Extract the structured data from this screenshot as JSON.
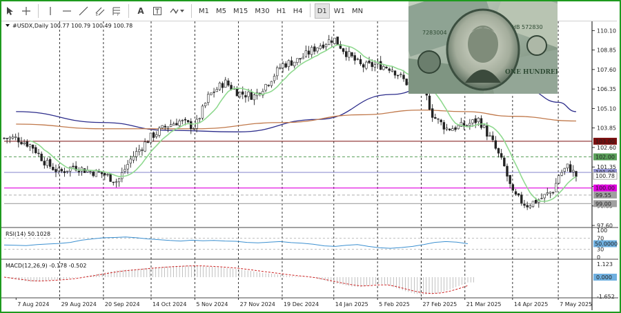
{
  "toolbar": {
    "tools": [
      "cursor-icon",
      "crosshair-icon",
      "vertical-line-icon",
      "horizontal-line-icon",
      "trendline-icon",
      "equidistant-channel-icon",
      "fibonacci-icon",
      "text-icon",
      "text-label-icon",
      "arrows-icon"
    ],
    "text_tool": "A",
    "timeframes": [
      "M1",
      "M5",
      "M15",
      "M30",
      "H1",
      "H4",
      "D1",
      "W1",
      "MN"
    ],
    "active_timeframe": "D1"
  },
  "chart_data": [
    {
      "type": "candlestick",
      "header": "#USDX,Daily  100.77 100.79 100.49 100.78",
      "ylim": [
        97.6,
        110.6
      ],
      "yticks": [
        "110.10",
        "108.85",
        "107.60",
        "106.35",
        "105.10",
        "103.85",
        "102.60",
        "101.35",
        "100.10",
        "98.85",
        "97.60"
      ],
      "x_labels": [
        "7 Aug 2024",
        "29 Aug 2024",
        "20 Sep 2024",
        "14 Oct 2024",
        "5 Nov 2024",
        "27 Nov 2024",
        "19 Dec 2024",
        "14 Jan 2025",
        "5 Feb 2025",
        "27 Feb 2025",
        "21 Mar 2025",
        "14 Apr 2025",
        "7 May 2025"
      ],
      "close_path_x": [
        "2024-08-07",
        "2024-08-15",
        "2024-08-22",
        "2024-08-29",
        "2024-09-05",
        "2024-09-12",
        "2024-09-20",
        "2024-09-27",
        "2024-10-04",
        "2024-10-14",
        "2024-10-22",
        "2024-10-28",
        "2024-11-05",
        "2024-11-12",
        "2024-11-20",
        "2024-11-27",
        "2024-12-05",
        "2024-12-12",
        "2024-12-19",
        "2024-12-27",
        "2025-01-06",
        "2025-01-14",
        "2025-01-20",
        "2025-01-28",
        "2025-02-05",
        "2025-02-12",
        "2025-02-20",
        "2025-02-27",
        "2025-03-05",
        "2025-03-12",
        "2025-03-21",
        "2025-03-28",
        "2025-04-04",
        "2025-04-10",
        "2025-04-14",
        "2025-04-21",
        "2025-04-28",
        "2025-05-05",
        "2025-05-07",
        "2025-05-12",
        "2025-05-16"
      ],
      "close": [
        103.2,
        102.7,
        101.6,
        101.0,
        101.4,
        101.1,
        100.9,
        100.4,
        101.9,
        103.3,
        104.0,
        104.3,
        103.9,
        105.9,
        106.8,
        106.1,
        105.9,
        106.8,
        107.9,
        108.2,
        109.1,
        109.6,
        108.7,
        107.8,
        107.9,
        107.7,
        106.7,
        106.8,
        104.6,
        103.8,
        104.0,
        104.4,
        102.9,
        101.3,
        99.6,
        98.9,
        99.3,
        99.9,
        100.8,
        101.4,
        100.78
      ],
      "series": [
        {
          "name": "",
          "color": "#8fd98f",
          "kind": "sma-fast"
        },
        {
          "name": "",
          "color": "#2b2b8a",
          "kind": "sma-100",
          "x": [
            "2024-08-07",
            "2024-09-20",
            "2024-10-22",
            "2024-11-27",
            "2025-01-06",
            "2025-02-12",
            "2025-03-05",
            "2025-03-28",
            "2025-04-21",
            "2025-05-07",
            "2025-05-16"
          ],
          "y": [
            104.9,
            104.2,
            103.7,
            103.6,
            104.4,
            106.0,
            106.6,
            106.6,
            106.3,
            105.5,
            104.9
          ]
        },
        {
          "name": "",
          "color": "#c0784a",
          "kind": "sma-200",
          "x": [
            "2024-08-07",
            "2024-09-20",
            "2024-11-05",
            "2024-12-19",
            "2025-01-28",
            "2025-02-27",
            "2025-03-21",
            "2025-04-14",
            "2025-05-16"
          ],
          "y": [
            104.1,
            103.8,
            103.8,
            104.2,
            104.7,
            105.0,
            104.9,
            104.6,
            104.3
          ]
        }
      ],
      "levels": [
        {
          "value": "103.00",
          "y": 103.0,
          "color": "#7a0e0e",
          "style": "solid",
          "text_color": "#ffffff"
        },
        {
          "value": "102.00",
          "y": 102.0,
          "color": "#5aa05a",
          "style": "dashed",
          "text_color": "#ffffff"
        },
        {
          "value": "101.00",
          "y": 101.0,
          "color": "#9090d0",
          "style": "solid",
          "text_color": "#ffffff"
        },
        {
          "value": "100.78",
          "y": 100.78,
          "color": "#ffffff",
          "style": "none",
          "text_color": "#000000",
          "current": true
        },
        {
          "value": "100.00",
          "y": 100.0,
          "color": "#e000e0",
          "style": "solid",
          "text_color": "#ffffff"
        },
        {
          "value": "99.55",
          "y": 99.55,
          "color": "#a0a0a0",
          "style": "dashed",
          "text_color": "#ffffff"
        },
        {
          "value": "99.00",
          "y": 99.0,
          "color": "#a0a0a0",
          "style": "solid",
          "text_color": "#ffffff"
        }
      ]
    },
    {
      "type": "line",
      "header": "RSI(14) 50.1028",
      "ylim": [
        0,
        100
      ],
      "yticks": [
        "100",
        "70",
        "30",
        "0"
      ],
      "current_label": "50.0000",
      "series": [
        {
          "name": "",
          "color": "#3a8fd0"
        }
      ],
      "y": [
        45,
        44,
        43,
        47,
        49,
        51,
        55,
        63,
        68,
        72,
        73,
        75,
        72,
        68,
        65,
        62,
        60,
        63,
        61,
        62,
        60,
        59,
        55,
        53,
        56,
        58,
        54,
        52,
        48,
        42,
        40,
        44,
        47,
        40,
        35,
        33,
        36,
        40,
        47,
        55,
        58,
        56,
        50
      ]
    },
    {
      "type": "bar",
      "header": "MACD(12,26,9) -0.178 -0.502",
      "ylim": [
        -1.652,
        1.123
      ],
      "yticks": [
        "1.123",
        "0.000",
        "-1.652"
      ],
      "current_label": "0.000",
      "histogram": [
        0.0,
        -0.15,
        -0.3,
        -0.4,
        -0.35,
        -0.25,
        -0.2,
        -0.15,
        -0.05,
        0.05,
        0.2,
        0.35,
        0.5,
        0.6,
        0.65,
        0.7,
        0.78,
        0.85,
        0.9,
        0.95,
        0.98,
        1.0,
        0.95,
        0.9,
        0.85,
        0.78,
        0.7,
        0.6,
        0.5,
        0.35,
        0.3,
        0.2,
        0.1,
        0.05,
        0.0,
        -0.1,
        -0.3,
        -0.5,
        -0.65,
        -0.8,
        -0.85,
        -0.7,
        -0.55,
        -0.65,
        -0.95,
        -1.2,
        -1.4,
        -1.5,
        -1.45,
        -1.3,
        -1.05,
        -0.75,
        -0.45
      ],
      "signal": [
        0.0,
        -0.1,
        -0.2,
        -0.3,
        -0.33,
        -0.3,
        -0.25,
        -0.2,
        -0.12,
        0.0,
        0.12,
        0.25,
        0.38,
        0.5,
        0.58,
        0.65,
        0.72,
        0.79,
        0.85,
        0.9,
        0.94,
        0.97,
        0.97,
        0.94,
        0.9,
        0.84,
        0.78,
        0.7,
        0.6,
        0.49,
        0.4,
        0.3,
        0.2,
        0.12,
        0.05,
        -0.05,
        -0.2,
        -0.36,
        -0.51,
        -0.65,
        -0.75,
        -0.73,
        -0.66,
        -0.66,
        -0.8,
        -1.0,
        -1.2,
        -1.35,
        -1.4,
        -1.35,
        -1.2,
        -0.98,
        -0.72
      ],
      "series": [
        {
          "name": "",
          "color": "#b0b0b0"
        },
        {
          "name": "",
          "color": "#cc2020"
        }
      ]
    }
  ],
  "colors": {
    "frame": "#1e9a1e",
    "bull": "#222222",
    "bear": "#222222",
    "grid": "#000000",
    "axis_text": "#222222"
  }
}
